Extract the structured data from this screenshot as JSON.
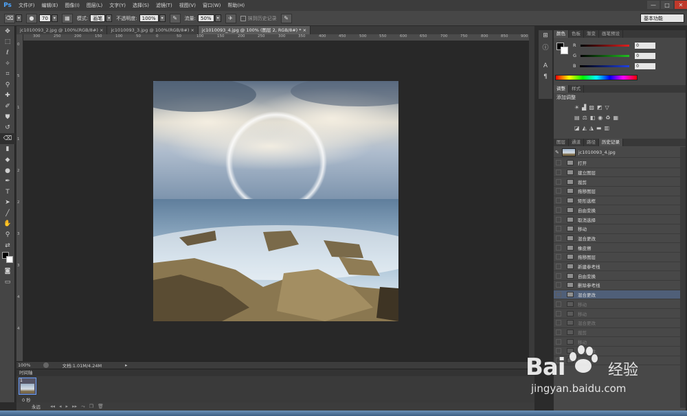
{
  "app": {
    "logo": "Ps"
  },
  "menu": [
    "文件(F)",
    "编辑(E)",
    "图像(I)",
    "图层(L)",
    "文字(Y)",
    "选择(S)",
    "滤镜(T)",
    "视图(V)",
    "窗口(W)",
    "帮助(H)"
  ],
  "window_controls": {
    "minimize": "—",
    "restore": "□",
    "close": "✕"
  },
  "options": {
    "brush_size": "70",
    "mode_label": "模式:",
    "mode_value": "画笔",
    "opacity_label": "不透明度:",
    "opacity_value": "100%",
    "flow_label": "流量:",
    "flow_value": "50%",
    "erase_history_label": "抹到历史记录",
    "workspace": "基本功能"
  },
  "tabs": [
    {
      "label": "jc1010093_2.jpg @ 100%(RGB/8#)",
      "close": "×",
      "active": false
    },
    {
      "label": "jc1010093_3.jpg @ 100%(RGB/8#)",
      "close": "×",
      "active": false
    },
    {
      "label": "jc1010093_4.jpg @ 100% (图层 2, RGB/8#) *",
      "close": "×",
      "active": true
    }
  ],
  "ruler_top": [
    "300",
    "250",
    "200",
    "150",
    "100",
    "50",
    "0",
    "50",
    "100",
    "150",
    "200",
    "250",
    "300",
    "350",
    "400",
    "450",
    "500",
    "550",
    "600",
    "650",
    "700",
    "750",
    "800",
    "850",
    "900"
  ],
  "ruler_left": [
    "0",
    "5",
    "1",
    "1",
    "2",
    "2",
    "3",
    "3",
    "4",
    "4"
  ],
  "status": {
    "zoom": "100%",
    "doc_label": "文档:1.01M/4.24M"
  },
  "timeline": {
    "tab": "时间轴",
    "frame_number": "1",
    "frame_time": "0 秒",
    "loop": "永远"
  },
  "panels": {
    "color_tabs": [
      "颜色",
      "色板",
      "渐变",
      "画笔预设"
    ],
    "color_channels": [
      {
        "label": "R",
        "value": "0",
        "color": "#e02020"
      },
      {
        "label": "G",
        "value": "0",
        "color": "#20c020"
      },
      {
        "label": "B",
        "value": "0",
        "color": "#2040e0"
      }
    ],
    "adjust_tabs": [
      "调整",
      "样式"
    ],
    "adjust_title": "添加调整",
    "history_tabs": [
      "图层",
      "通道",
      "路径",
      "历史记录"
    ],
    "history_snapshot": "jc1010093_4.jpg",
    "history_items": [
      {
        "label": "打开",
        "state": "normal"
      },
      {
        "label": "建立图层",
        "state": "normal"
      },
      {
        "label": "裁剪",
        "state": "normal"
      },
      {
        "label": "拖移图层",
        "state": "normal"
      },
      {
        "label": "矩形选框",
        "state": "normal"
      },
      {
        "label": "自由变换",
        "state": "normal"
      },
      {
        "label": "取消选择",
        "state": "normal"
      },
      {
        "label": "移动",
        "state": "normal"
      },
      {
        "label": "混合更改",
        "state": "normal"
      },
      {
        "label": "橡皮擦",
        "state": "normal"
      },
      {
        "label": "拖移图层",
        "state": "normal"
      },
      {
        "label": "新建参考线",
        "state": "normal"
      },
      {
        "label": "自由变换",
        "state": "normal"
      },
      {
        "label": "删除参考线",
        "state": "normal"
      },
      {
        "label": "混合更改",
        "state": "selected"
      },
      {
        "label": "移动",
        "state": "dim"
      },
      {
        "label": "移动",
        "state": "dim"
      },
      {
        "label": "混合更改",
        "state": "dim"
      },
      {
        "label": "裁剪",
        "state": "dim"
      },
      {
        "label": "移动",
        "state": "dim"
      },
      {
        "label": "混合更改",
        "state": "dim"
      },
      {
        "label": "移动",
        "state": "dim"
      }
    ]
  },
  "watermark": {
    "brand": "Bai",
    "brand_cn": "经验",
    "url": "jingyan.baidu.com"
  }
}
